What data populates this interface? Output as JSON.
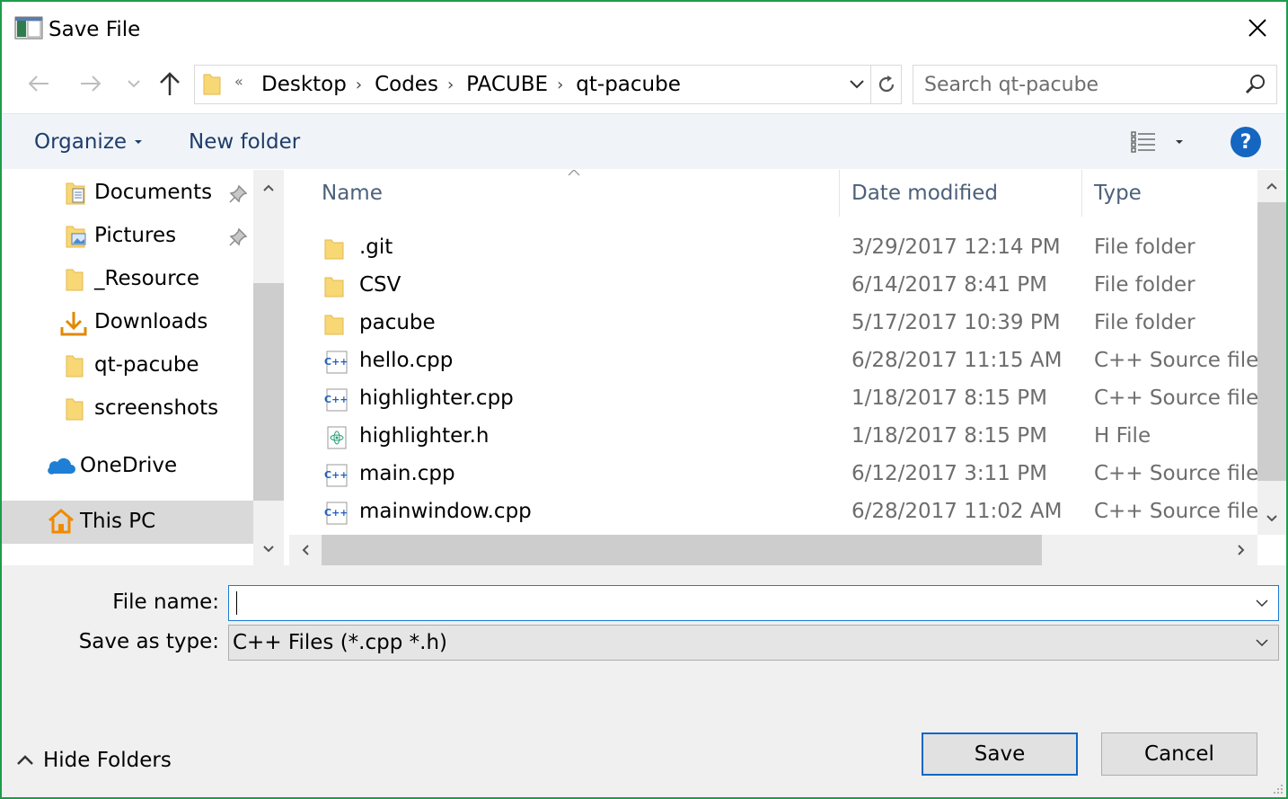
{
  "window": {
    "title": "Save File"
  },
  "navbar": {
    "breadcrumbs": [
      "Desktop",
      "Codes",
      "PACUBE",
      "qt-pacube"
    ],
    "overflow_glyph": "«",
    "search_placeholder": "Search qt-pacube"
  },
  "commands": {
    "organize": "Organize",
    "new_folder": "New folder",
    "help": "?"
  },
  "sidebar": {
    "items": [
      {
        "label": "Documents",
        "icon": "documents-folder-icon",
        "pinned": true
      },
      {
        "label": "Pictures",
        "icon": "pictures-folder-icon",
        "pinned": true
      },
      {
        "label": "_Resource",
        "icon": "folder-icon",
        "pinned": false
      },
      {
        "label": "Downloads",
        "icon": "downloads-icon",
        "pinned": false
      },
      {
        "label": "qt-pacube",
        "icon": "folder-icon",
        "pinned": false
      },
      {
        "label": "screenshots",
        "icon": "folder-icon",
        "pinned": false
      },
      {
        "label": "OneDrive",
        "icon": "onedrive-icon",
        "pinned": false
      },
      {
        "label": "This PC",
        "icon": "this-pc-icon",
        "pinned": false,
        "selected": true
      }
    ]
  },
  "filelist": {
    "columns": {
      "name": "Name",
      "date": "Date modified",
      "type": "Type"
    },
    "rows": [
      {
        "name": ".git",
        "date": "3/29/2017 12:14 PM",
        "type": "File folder",
        "icon": "folder-icon"
      },
      {
        "name": "CSV",
        "date": "6/14/2017 8:41 PM",
        "type": "File folder",
        "icon": "folder-icon"
      },
      {
        "name": "pacube",
        "date": "5/17/2017 10:39 PM",
        "type": "File folder",
        "icon": "folder-icon"
      },
      {
        "name": "hello.cpp",
        "date": "6/28/2017 11:15 AM",
        "type": "C++ Source file",
        "icon": "cpp-file-icon"
      },
      {
        "name": "highlighter.cpp",
        "date": "1/18/2017 8:15 PM",
        "type": "C++ Source file",
        "icon": "cpp-file-icon"
      },
      {
        "name": "highlighter.h",
        "date": "1/18/2017 8:15 PM",
        "type": "H File",
        "icon": "h-file-icon"
      },
      {
        "name": "main.cpp",
        "date": "6/12/2017 3:11 PM",
        "type": "C++ Source file",
        "icon": "cpp-file-icon"
      },
      {
        "name": "mainwindow.cpp",
        "date": "6/28/2017 11:02 AM",
        "type": "C++ Source file",
        "icon": "cpp-file-icon"
      }
    ]
  },
  "form": {
    "file_name_label": "File name:",
    "file_name_value": "",
    "save_type_label": "Save as type:",
    "save_type_value": "C++ Files (*.cpp *.h)"
  },
  "footer": {
    "hide_folders": "Hide Folders",
    "save": "Save",
    "cancel": "Cancel"
  },
  "colors": {
    "window_border": "#1e9c4a",
    "link_text": "#1e3d6a",
    "primary_border": "#0f66c6",
    "folder": "#f8d775"
  }
}
